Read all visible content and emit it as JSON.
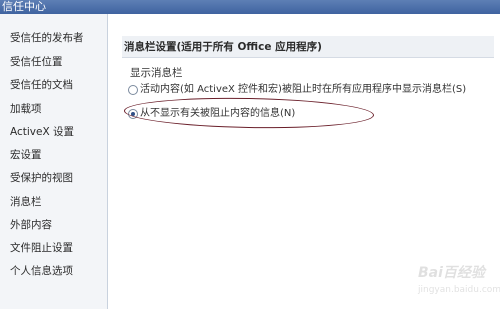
{
  "window": {
    "title": "信任中心"
  },
  "sidebar": {
    "items": [
      {
        "label": "受信任的发布者"
      },
      {
        "label": "受信任位置"
      },
      {
        "label": "受信任的文档"
      },
      {
        "label": "加载项"
      },
      {
        "label": "ActiveX 设置"
      },
      {
        "label": "宏设置"
      },
      {
        "label": "受保护的视图"
      },
      {
        "label": "消息栏",
        "selected": true
      },
      {
        "label": "外部内容"
      },
      {
        "label": "文件阻止设置"
      },
      {
        "label": "个人信息选项"
      }
    ]
  },
  "main": {
    "section_title": "消息栏设置(适用于所有 Office 应用程序)",
    "group_label": "显示消息栏",
    "options": [
      {
        "label": "活动内容(如 ActiveX 控件和宏)被阻止时在所有应用程序中显示消息栏(S)",
        "checked": false
      },
      {
        "label": "从不显示有关被阻止内容的信息(N)",
        "checked": true
      }
    ]
  },
  "watermark": {
    "text": "Bai百经验",
    "site": "jingyan.baidu.com"
  }
}
